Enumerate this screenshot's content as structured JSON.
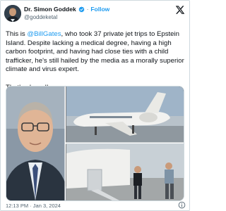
{
  "author": {
    "name": "Dr. Simon Goddek",
    "handle": "@goddeketal",
    "follow_label": "Follow",
    "separator": "·",
    "verified": true,
    "avatar_icon": "profile-photo"
  },
  "tweet": {
    "text_before": "This is ",
    "mention": "@BillGates",
    "text_after": ", who took 37 private jet trips to Epstein Island. Despite lacking a medical degree, having a high carbon footprint, and having had close ties with a child trafficker, he's still hailed by the media as a morally superior climate and virus expert.",
    "closing": "That's absurd!"
  },
  "media": {
    "left_image": "portrait-photo",
    "top_right_image": "private-jet-photo",
    "bottom_right_image": "jet-boarding-photo"
  },
  "footer": {
    "timestamp": "12:13 PM · Jan 3, 2024",
    "info_icon": "info-icon"
  },
  "colors": {
    "accent": "#1d9bf0",
    "text": "#0f1419",
    "muted": "#536471",
    "border": "#cfd9de"
  }
}
